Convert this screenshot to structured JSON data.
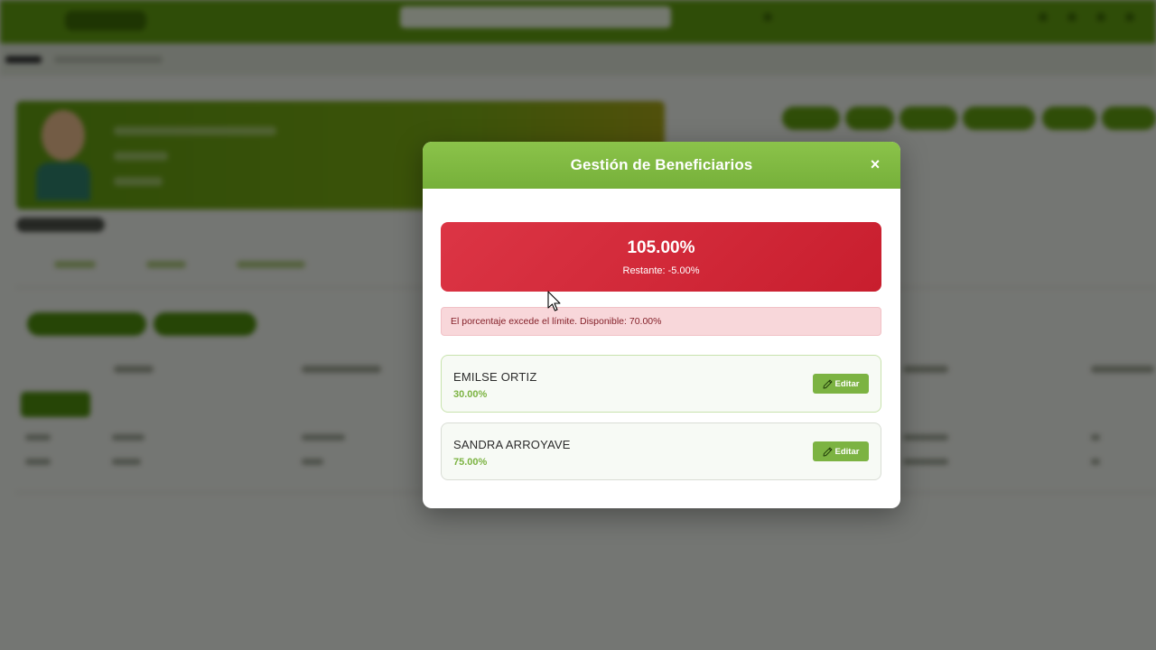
{
  "modal": {
    "title": "Gestión de Beneficiarios",
    "close_label": "×",
    "total": {
      "value": "105.00%",
      "remaining_text": "Restante: -5.00%",
      "bg_color": "#dc3545"
    },
    "alert_text": "El porcentaje excede el límite. Disponible: 70.00%",
    "beneficiaries": [
      {
        "name": "EMILSE ORTIZ",
        "percentage": "30.00%",
        "edit_label": "Editar"
      },
      {
        "name": "SANDRA ARROYAVE",
        "percentage": "75.00%",
        "edit_label": "Editar"
      }
    ]
  },
  "colors": {
    "brand_green": "#7cb342",
    "danger": "#dc3545",
    "alert_bg": "#f8d7da"
  }
}
